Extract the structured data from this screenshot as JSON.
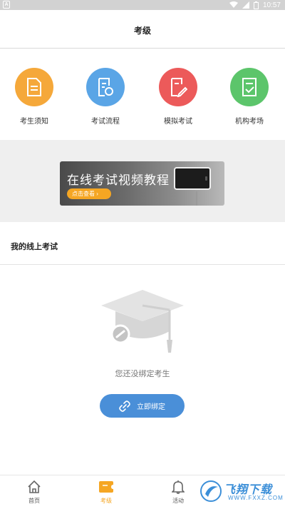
{
  "status_bar": {
    "notification_icon": "A",
    "time": "10:57",
    "icons": [
      "wifi-icon",
      "signal-no-sim-icon",
      "battery-icon"
    ]
  },
  "header": {
    "title": "考级"
  },
  "features": [
    {
      "label": "考生须知",
      "icon": "document-icon",
      "color": "#f5a83a"
    },
    {
      "label": "考试流程",
      "icon": "process-icon",
      "color": "#5aa5e6"
    },
    {
      "label": "模拟考试",
      "icon": "edit-icon",
      "color": "#ec5a5a"
    },
    {
      "label": "机构考场",
      "icon": "checklist-icon",
      "color": "#5cc56b"
    }
  ],
  "banner": {
    "title": "在线考试视频教程",
    "button_label": "点击查看 ›"
  },
  "section": {
    "title": "我的线上考试"
  },
  "empty_state": {
    "message": "您还没绑定考生",
    "button_label": "立即绑定",
    "button_color": "#4a8fd8"
  },
  "tabbar": {
    "items": [
      {
        "label": "首页",
        "icon": "home-icon",
        "active": false
      },
      {
        "label": "考级",
        "icon": "ticket-icon",
        "active": true
      },
      {
        "label": "活动",
        "icon": "bell-icon",
        "active": false
      }
    ],
    "active_color": "#f5a623"
  },
  "watermark": {
    "text": "飞翔下载",
    "sub": "WWW.FXXZ.COM"
  }
}
